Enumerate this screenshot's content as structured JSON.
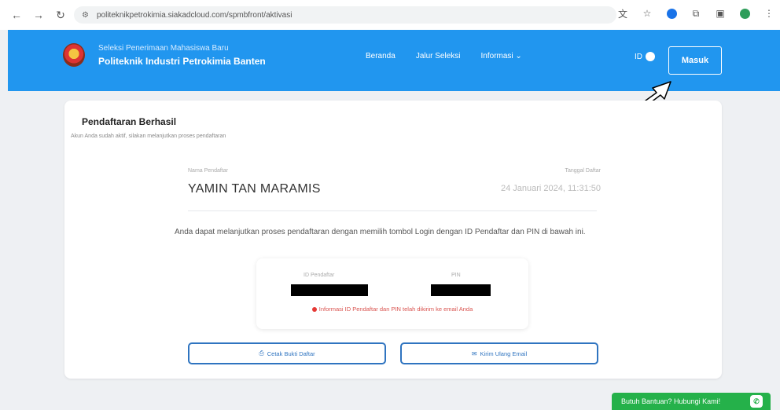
{
  "browser": {
    "url": "politeknikpetrokimia.siakadcloud.com/spmbfront/aktivasi"
  },
  "header": {
    "brand_subtitle": "Seleksi Penerimaan Mahasiswa Baru",
    "brand_title": "Politeknik Industri Petrokimia Banten",
    "nav": [
      "Beranda",
      "Jalur Seleksi",
      "Informasi ⌄"
    ],
    "lang": "ID",
    "login_label": "Masuk"
  },
  "card": {
    "title": "Pendaftaran Berhasil",
    "description": "Akun Anda sudah aktif, silakan melanjutkan proses pendaftaran",
    "name_label": "Nama Pendaftar",
    "name_value": "YAMIN TAN MARAMIS",
    "date_label": "Tanggal Daftar",
    "date_value": "24 Januari 2024, 11:31:50",
    "info_text": "Anda dapat melanjutkan proses pendaftaran dengan memilih tombol Login dengan ID Pendaftar dan PIN di bawah ini.",
    "id_label": "ID Pendaftar",
    "pin_label": "PIN",
    "notice": "Informasi ID Pendaftar dan PIN telah dikirim ke email Anda",
    "print_button": "Cetak Bukti Daftar",
    "resend_button": "Kirim Ulang Email"
  },
  "help": {
    "label": "Butuh Bantuan? Hubungi Kami!"
  },
  "colors": {
    "header": "#2196ef",
    "button_border": "#2f74c0",
    "notice": "#d9534f",
    "help": "#25b14a"
  }
}
